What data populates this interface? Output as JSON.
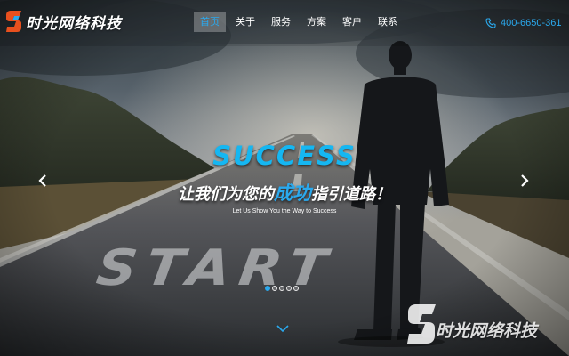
{
  "brand": {
    "name": "时光网络科技",
    "accent_color": "#2aa9ee",
    "logo_color": "#e8501e"
  },
  "nav": {
    "items": [
      {
        "label": "首页",
        "active": true
      },
      {
        "label": "关于",
        "active": false
      },
      {
        "label": "服务",
        "active": false
      },
      {
        "label": "方案",
        "active": false
      },
      {
        "label": "客户",
        "active": false
      },
      {
        "label": "联系",
        "active": false
      }
    ]
  },
  "contact": {
    "phone": "400-6650-361",
    "icon": "phone-icon"
  },
  "slide": {
    "headline": "SUCCESS",
    "slogan_pre": "让我们为您的",
    "slogan_highlight": "成功",
    "slogan_post": "指引道路！",
    "subline": "Let Us Show You the Way to Success",
    "road_text": "START"
  },
  "carousel": {
    "prev_icon": "chevron-left-icon",
    "next_icon": "chevron-right-icon",
    "slide_count": 5,
    "active_index": 0
  },
  "scroll": {
    "icon": "chevron-down-icon"
  },
  "watermark": {
    "text": "时光网络科技"
  }
}
